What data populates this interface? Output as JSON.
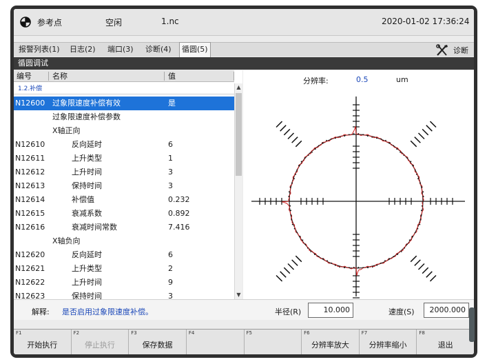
{
  "status": {
    "mode": "参考点",
    "state": "空闲",
    "program": "1.nc",
    "datetime": "2020-01-02 17:36:24"
  },
  "tabs": [
    {
      "label": "报警列表(1)"
    },
    {
      "label": "日志(2)"
    },
    {
      "label": "端口(3)"
    },
    {
      "label": "诊断(4)"
    },
    {
      "label": "循圆(5)"
    }
  ],
  "diag_label": "诊断",
  "section_title": "循圆调试",
  "table": {
    "headers": {
      "id": "编号",
      "name": "名称",
      "value": "值"
    },
    "group": "1.2.补偿",
    "rows": [
      {
        "id": "N12600",
        "name": "过象限速度补偿有效",
        "value": "是"
      },
      {
        "id": "",
        "name": "过象限速度补偿参数",
        "value": ""
      },
      {
        "id": "",
        "name": "X轴正向",
        "value": ""
      },
      {
        "id": "N12610",
        "name": "反向延时",
        "value": "6"
      },
      {
        "id": "N12611",
        "name": "上升类型",
        "value": "1"
      },
      {
        "id": "N12612",
        "name": "上升时间",
        "value": "3"
      },
      {
        "id": "N12613",
        "name": "保持时间",
        "value": "3"
      },
      {
        "id": "N12614",
        "name": "补偿值",
        "value": "0.232"
      },
      {
        "id": "N12615",
        "name": "衰减系数",
        "value": "0.892"
      },
      {
        "id": "N12616",
        "name": "衰减时间常数",
        "value": "7.416"
      },
      {
        "id": "",
        "name": "X轴负向",
        "value": ""
      },
      {
        "id": "N12620",
        "name": "反向延时",
        "value": "6"
      },
      {
        "id": "N12621",
        "name": "上升类型",
        "value": "2"
      },
      {
        "id": "N12622",
        "name": "上升时间",
        "value": "9"
      },
      {
        "id": "N12623",
        "name": "保持时间",
        "value": "3"
      }
    ]
  },
  "chart": {
    "resolution_label": "分辨率:",
    "resolution_value": "0.5",
    "resolution_unit": "um"
  },
  "info": {
    "desc_label": "解释:",
    "desc_text": "是否启用过象限速度补偿。",
    "radius_label": "半径(R)",
    "radius_value": "10.000",
    "speed_label": "速度(S)",
    "speed_value": "2000.000"
  },
  "fkeys": [
    {
      "num": "F1",
      "label": "开始执行",
      "enabled": true
    },
    {
      "num": "F2",
      "label": "停止执行",
      "enabled": false
    },
    {
      "num": "F3",
      "label": "保存数据",
      "enabled": true
    },
    {
      "num": "F4",
      "label": "",
      "enabled": true
    },
    {
      "num": "F5",
      "label": "",
      "enabled": true
    },
    {
      "num": "F6",
      "label": "分辨率放大",
      "enabled": true
    },
    {
      "num": "F7",
      "label": "分辨率缩小",
      "enabled": true
    },
    {
      "num": "F8",
      "label": "退出",
      "enabled": true
    }
  ],
  "colors": {
    "accent": "#1e73d9",
    "trace": "#cc1f1f",
    "link_text": "#1a47b8"
  }
}
